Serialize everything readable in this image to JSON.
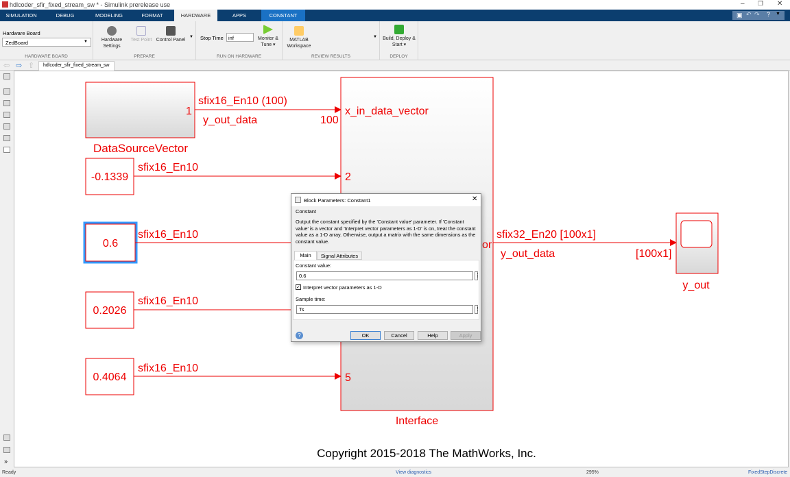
{
  "window": {
    "title": "hdlcoder_sfir_fixed_stream_sw * - Simulink prerelease use"
  },
  "tabs": [
    "SIMULATION",
    "DEBUG",
    "MODELING",
    "FORMAT",
    "HARDWARE",
    "APPS",
    "CONSTANT"
  ],
  "active_tab": "HARDWARE",
  "toolstrip": {
    "hardware_board": {
      "label": "Hardware Board",
      "value": "ZedBoard",
      "section": "HARDWARE BOARD"
    },
    "prepare": {
      "section": "PREPARE",
      "hardware_settings": "Hardware Settings",
      "test_point": "Test Point",
      "control_panel": "Control Panel"
    },
    "run": {
      "section": "RUN ON HARDWARE",
      "stop_time_label": "Stop Time",
      "stop_time": "inf",
      "monitor": "Monitor & Tune ▾"
    },
    "review": {
      "section": "REVIEW RESULTS",
      "matlab_workspace": "MATLAB Workspace"
    },
    "deploy": {
      "section": "DEPLOY",
      "build": "Build, Deploy & Start ▾"
    }
  },
  "breadcrumb": "hdlcoder_sfir_fixed_stream_sw",
  "diagram": {
    "source": {
      "name": "DataSourceVector",
      "port": "1",
      "sig_type": "sfix16_En10 (100)",
      "sig_name": "y_out_data",
      "dim": "100"
    },
    "constants": [
      {
        "value": "-0.1339",
        "sig_type": "sfix16_En10",
        "port": "2"
      },
      {
        "value": "0.6",
        "sig_type": "sfix16_En10",
        "port": ""
      },
      {
        "value": "0.2026",
        "sig_type": "sfix16_En10",
        "port": ""
      },
      {
        "value": "0.4064",
        "sig_type": "sfix16_En10",
        "port": "5"
      }
    ],
    "interface": {
      "name": "Interface",
      "in_port": "x_in_data_vector",
      "out_port_partial": "or"
    },
    "output": {
      "sig_type": "sfix32_En20 [100x1]",
      "sig_name": "y_out_data",
      "dim": "[100x1]",
      "scope": "y_out"
    },
    "copyright": "Copyright 2015-2018 The MathWorks, Inc.",
    "colors": {
      "block": "#e00000",
      "selected": "#3399ff"
    }
  },
  "dialog": {
    "title": "Block Parameters: Constant1",
    "group": "Constant",
    "description": "Output the constant specified by the 'Constant value' parameter. If 'Constant value' is a vector and 'Interpret vector parameters as 1-D' is on, treat the constant value as a 1-D array. Otherwise, output a matrix with the same dimensions as the constant value.",
    "tabs": [
      "Main",
      "Signal Attributes"
    ],
    "constant_label": "Constant value:",
    "constant_value": "0.6",
    "interpret_label": "Interpret vector parameters as 1-D",
    "interpret_checked": true,
    "sample_label": "Sample time:",
    "sample_value": "Ts",
    "buttons": {
      "ok": "OK",
      "cancel": "Cancel",
      "help": "Help",
      "apply": "Apply"
    }
  },
  "status": {
    "left": "Ready",
    "diagnostics": "View diagnostics",
    "zoom": "295%",
    "solver": "FixedStepDiscrete"
  }
}
